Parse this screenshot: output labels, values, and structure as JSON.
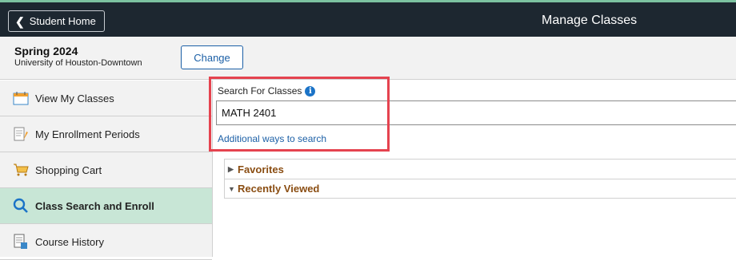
{
  "header": {
    "back_label": "Student Home",
    "title": "Manage Classes"
  },
  "term": {
    "name": "Spring 2024",
    "institution": "University of Houston-Downtown",
    "change_label": "Change"
  },
  "sidebar": {
    "items": [
      {
        "label": "View My Classes",
        "icon": "calendar-icon",
        "active": false
      },
      {
        "label": "My Enrollment Periods",
        "icon": "enrollment-periods-icon",
        "active": false
      },
      {
        "label": "Shopping Cart",
        "icon": "shopping-cart-icon",
        "active": false
      },
      {
        "label": "Class Search and Enroll",
        "icon": "search-icon",
        "active": true
      },
      {
        "label": "Course History",
        "icon": "course-history-icon",
        "active": false
      }
    ]
  },
  "search": {
    "label": "Search For Classes",
    "value": "MATH 2401",
    "additional_link": "Additional ways to search"
  },
  "accordion": {
    "favorites": "Favorites",
    "recently_viewed": "Recently Viewed"
  },
  "colors": {
    "header_bg": "#1d2730",
    "accent_green": "#c8e6d6",
    "link_blue": "#1b5fa6",
    "highlight_red": "#e5434f",
    "accordion_text": "#8a4d12"
  }
}
